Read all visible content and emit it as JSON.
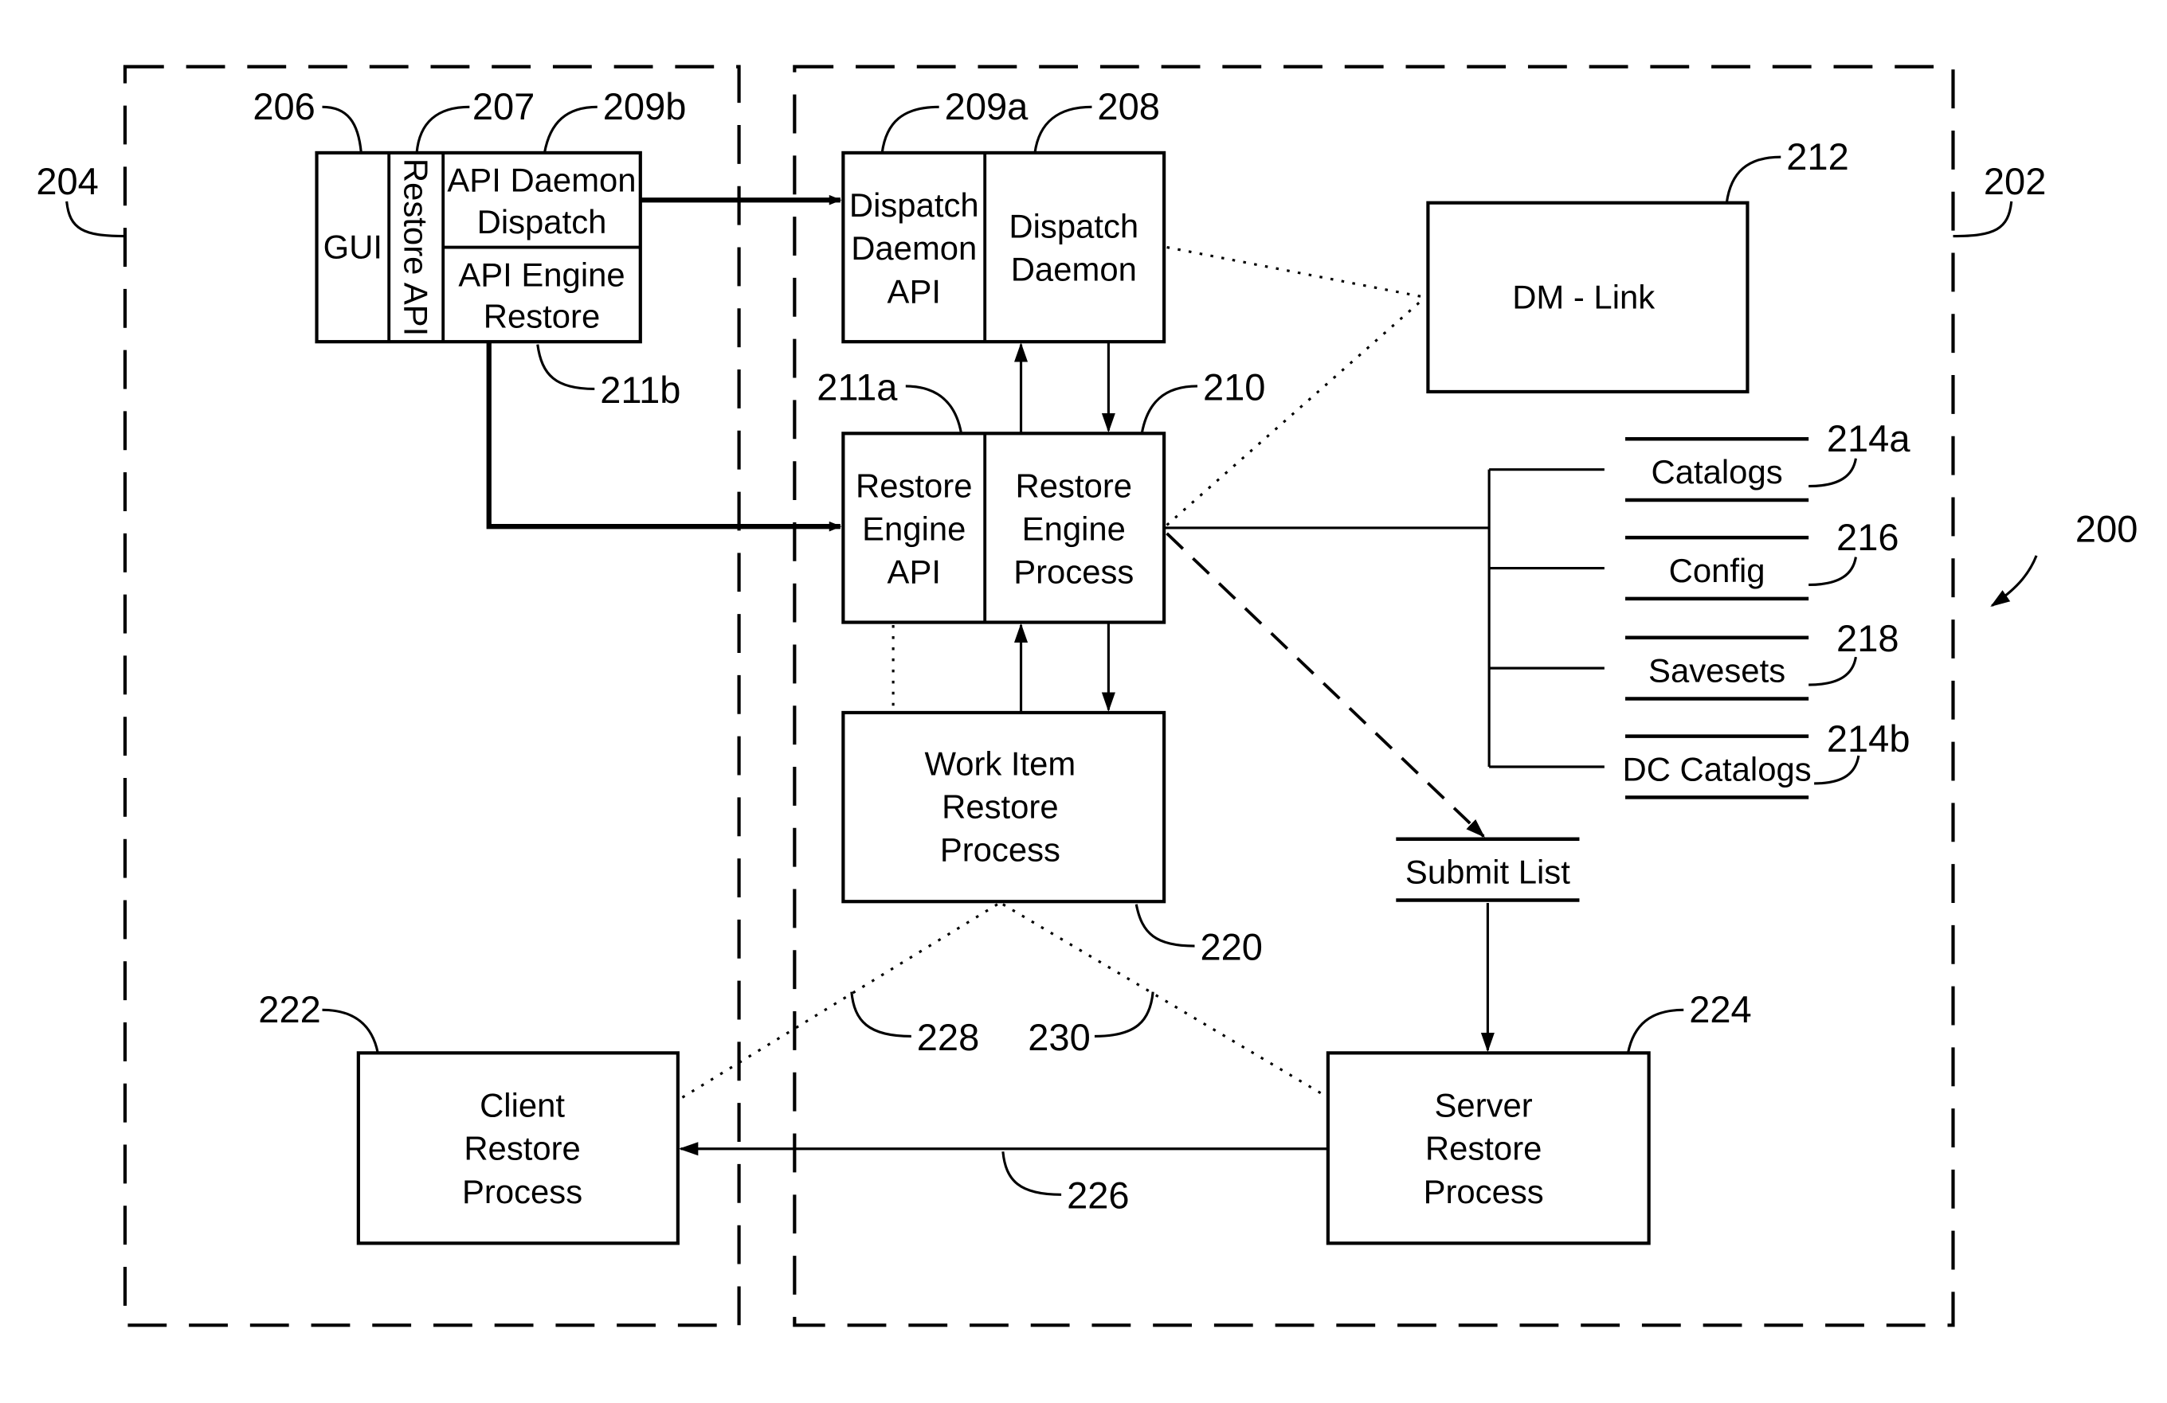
{
  "figure": {
    "ref": "200",
    "regions": {
      "client": {
        "ref": "204"
      },
      "server": {
        "ref": "202"
      }
    },
    "client_module": {
      "gui": {
        "label": "GUI",
        "ref": "206"
      },
      "restore_api": {
        "label": "Restore API",
        "ref": "207"
      },
      "api_daemon_dispatch": {
        "line1": "API Daemon",
        "line2": "Dispatch",
        "ref": "209b"
      },
      "api_engine_restore": {
        "line1": "API Engine",
        "line2": "Restore",
        "ref": "211b"
      }
    },
    "dispatch": {
      "api": {
        "line1": "Dispatch",
        "line2": "Daemon",
        "line3": "API",
        "ref": "209a"
      },
      "daemon": {
        "line1": "Dispatch",
        "line2": "Daemon",
        "ref": "208"
      }
    },
    "restore_engine": {
      "api": {
        "line1": "Restore",
        "line2": "Engine",
        "line3": "API",
        "ref": "211a"
      },
      "process": {
        "line1": "Restore",
        "line2": "Engine",
        "line3": "Process",
        "ref": "210"
      }
    },
    "dm_link": {
      "label": "DM - Link",
      "ref": "212"
    },
    "stores": [
      {
        "label": "Catalogs",
        "ref": "214a"
      },
      {
        "label": "Config",
        "ref": "216"
      },
      {
        "label": "Savesets",
        "ref": "218"
      },
      {
        "label": "DC Catalogs",
        "ref": "214b"
      }
    ],
    "work_item": {
      "line1": "Work Item",
      "line2": "Restore",
      "line3": "Process",
      "ref": "220"
    },
    "submit_list": {
      "label": "Submit List"
    },
    "client_restore": {
      "line1": "Client",
      "line2": "Restore",
      "line3": "Process",
      "ref": "222"
    },
    "server_restore": {
      "line1": "Server",
      "line2": "Restore",
      "line3": "Process",
      "ref": "224"
    },
    "connections": {
      "server_to_client": {
        "ref": "226"
      },
      "work_item_to_client": {
        "ref": "228"
      },
      "work_item_to_server": {
        "ref": "230"
      }
    }
  }
}
